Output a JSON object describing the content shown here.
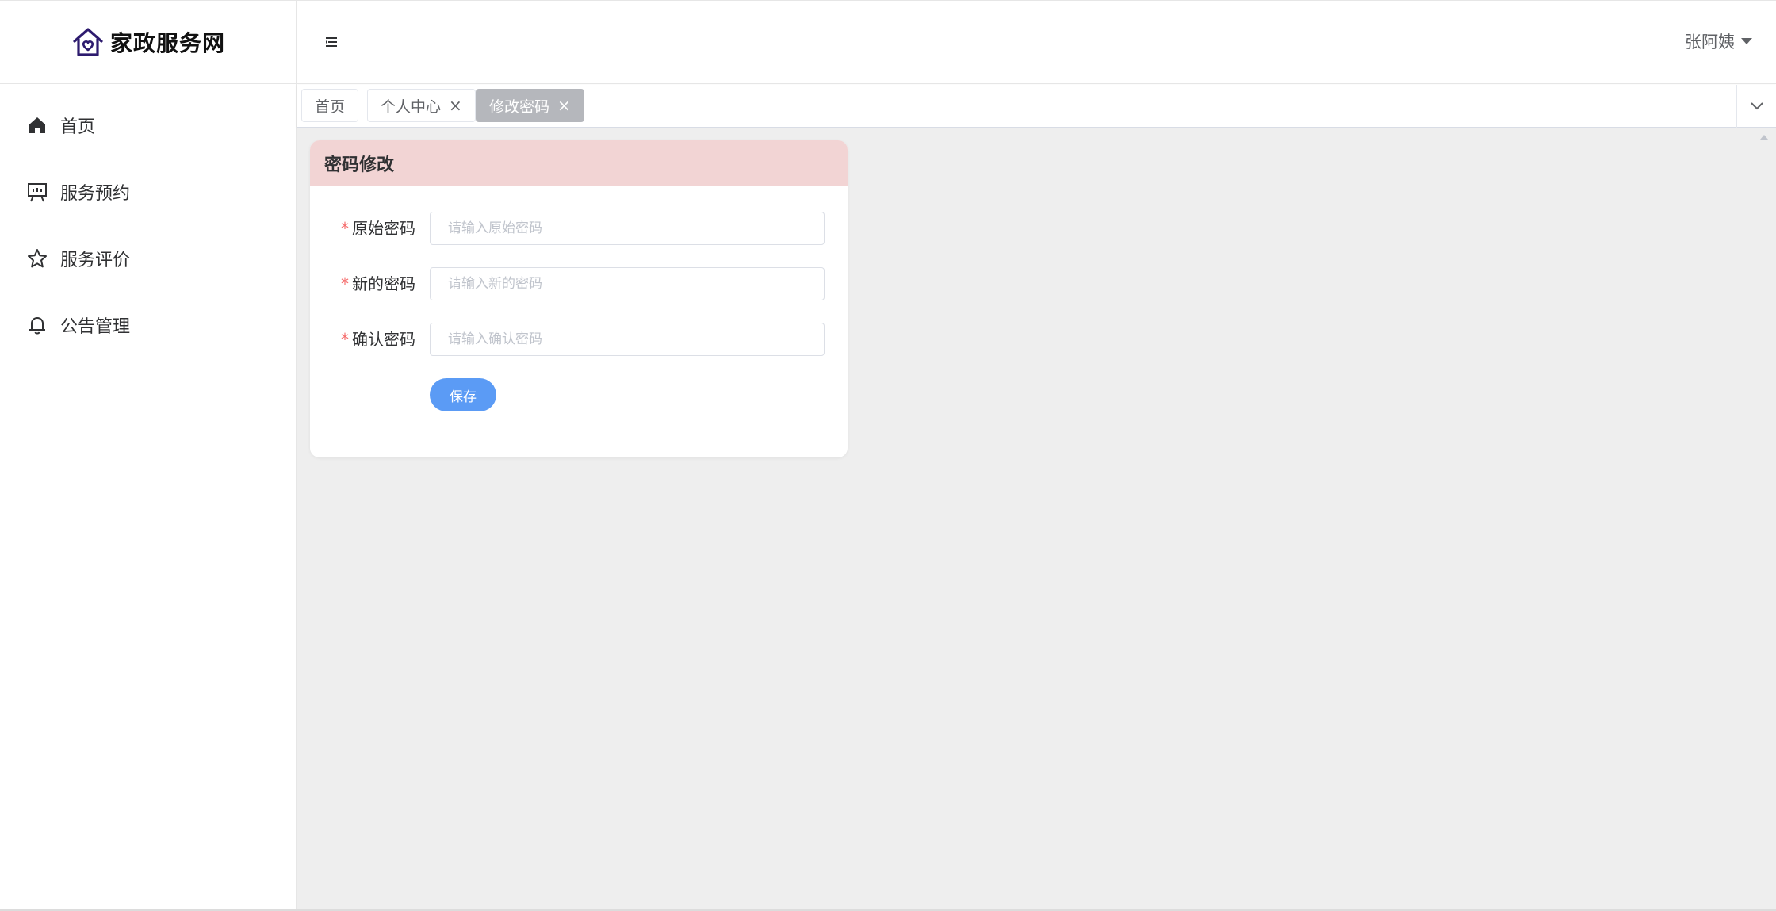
{
  "app": {
    "logo_text": "家政服务网"
  },
  "sidebar": {
    "items": [
      {
        "label": "首页",
        "icon": "home-icon"
      },
      {
        "label": "服务预约",
        "icon": "presentation-icon"
      },
      {
        "label": "服务评价",
        "icon": "star-icon"
      },
      {
        "label": "公告管理",
        "icon": "bell-icon"
      }
    ]
  },
  "header": {
    "user_name": "张阿姨"
  },
  "tabs": [
    {
      "label": "首页",
      "closable": false,
      "active": false
    },
    {
      "label": "个人中心",
      "closable": true,
      "active": false
    },
    {
      "label": "修改密码",
      "closable": true,
      "active": true
    }
  ],
  "card": {
    "title": "密码修改",
    "fields": [
      {
        "label": "原始密码",
        "placeholder": "请输入原始密码",
        "value": "",
        "required": true
      },
      {
        "label": "新的密码",
        "placeholder": "请输入新的密码",
        "value": "",
        "required": true
      },
      {
        "label": "确认密码",
        "placeholder": "请输入确认密码",
        "value": "",
        "required": true
      }
    ],
    "save_label": "保存"
  },
  "colors": {
    "accent": "#5b9bf5",
    "card_header_bg": "#f2d4d4",
    "active_tab_bg": "#b5b7bc",
    "required_mark": "#f56c6c",
    "content_bg": "#eeeeee",
    "logo_color": "#2d1b6e"
  },
  "close_glyph": "×",
  "required_glyph": "*"
}
